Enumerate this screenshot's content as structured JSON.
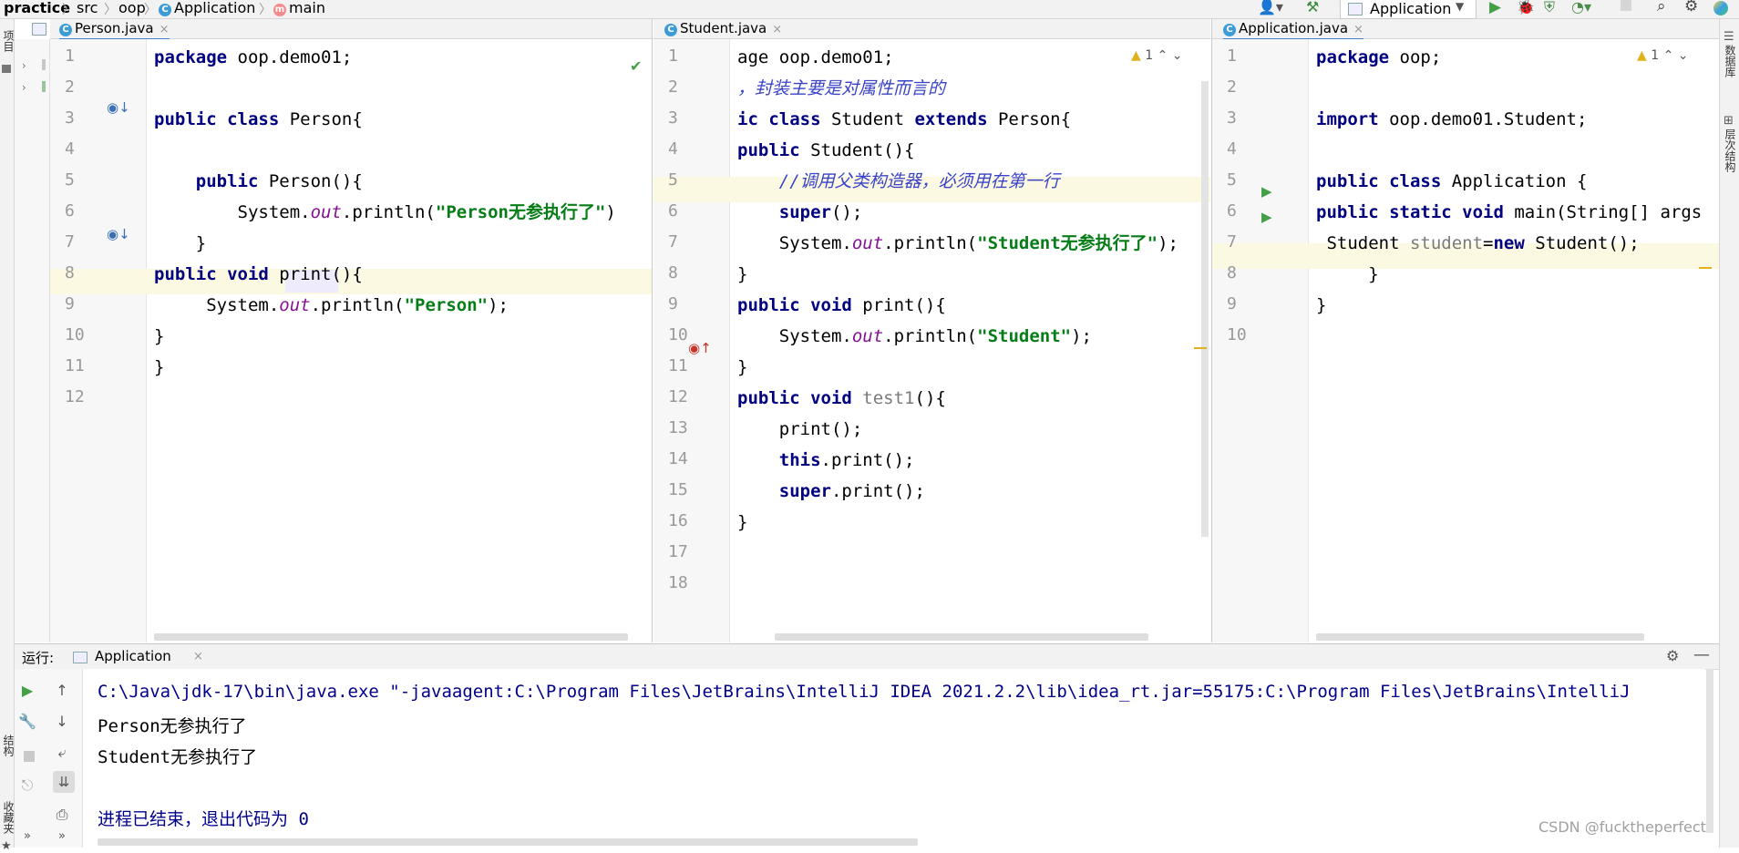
{
  "breadcrumb": {
    "project": "practice",
    "src": "src",
    "pkg": "oop",
    "cls": "Application",
    "method": "main"
  },
  "toolbar": {
    "run_config": "Application"
  },
  "side": {
    "project_label": "项目",
    "db_label": "数据库",
    "structure_label": "层次结构",
    "bottom_label1": "结构",
    "bottom_label2": "收藏夹"
  },
  "tabs": {
    "person": "Person.java",
    "student": "Student.java",
    "application": "Application.java"
  },
  "editor_person": {
    "lines": [
      "1",
      "2",
      "3",
      "4",
      "5",
      "6",
      "7",
      "8",
      "9",
      "10",
      "11",
      "12"
    ]
  },
  "editor_student": {
    "lines": [
      "1",
      "2",
      "3",
      "4",
      "5",
      "6",
      "7",
      "8",
      "9",
      "10",
      "11",
      "12",
      "13",
      "14",
      "15",
      "16",
      "17",
      "18"
    ],
    "warn": "1"
  },
  "editor_app": {
    "lines": [
      "1",
      "2",
      "3",
      "4",
      "5",
      "6",
      "7",
      "8",
      "9",
      "10"
    ],
    "warn": "1"
  },
  "run": {
    "label": "运行:",
    "tab": "Application",
    "console": [
      "C:\\Java\\jdk-17\\bin\\java.exe \"-javaagent:C:\\Program Files\\JetBrains\\IntelliJ IDEA 2021.2.2\\lib\\idea_rt.jar=55175:C:\\Program Files\\JetBrains\\IntelliJ",
      "Person无参执行了",
      "Student无参执行了",
      "",
      "进程已结束，退出代码为 0"
    ]
  },
  "watermark": "CSDN @fucktheperfect",
  "colors": {
    "keyword": "#000080",
    "string": "#067d17",
    "field": "#871094",
    "comment": "#3a43c7",
    "accent": "#4083c9"
  }
}
